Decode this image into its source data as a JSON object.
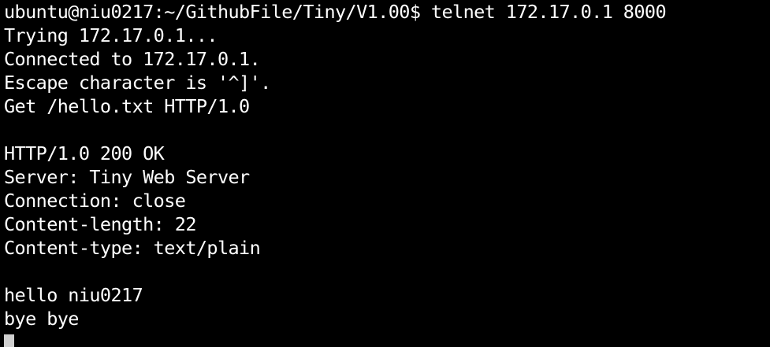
{
  "terminal": {
    "lines": [
      "ubuntu@niu0217:~/GithubFile/Tiny/V1.00$ telnet 172.17.0.1 8000",
      "Trying 172.17.0.1...",
      "Connected to 172.17.0.1.",
      "Escape character is '^]'.",
      "Get /hello.txt HTTP/1.0",
      "",
      "HTTP/1.0 200 OK",
      "Server: Tiny Web Server",
      "Connection: close",
      "Content-length: 22",
      "Content-type: text/plain",
      "",
      "hello niu0217",
      "bye bye"
    ],
    "colors": {
      "background": "#000000",
      "foreground": "#ffffff",
      "cursor": "#d0d0d0"
    }
  }
}
